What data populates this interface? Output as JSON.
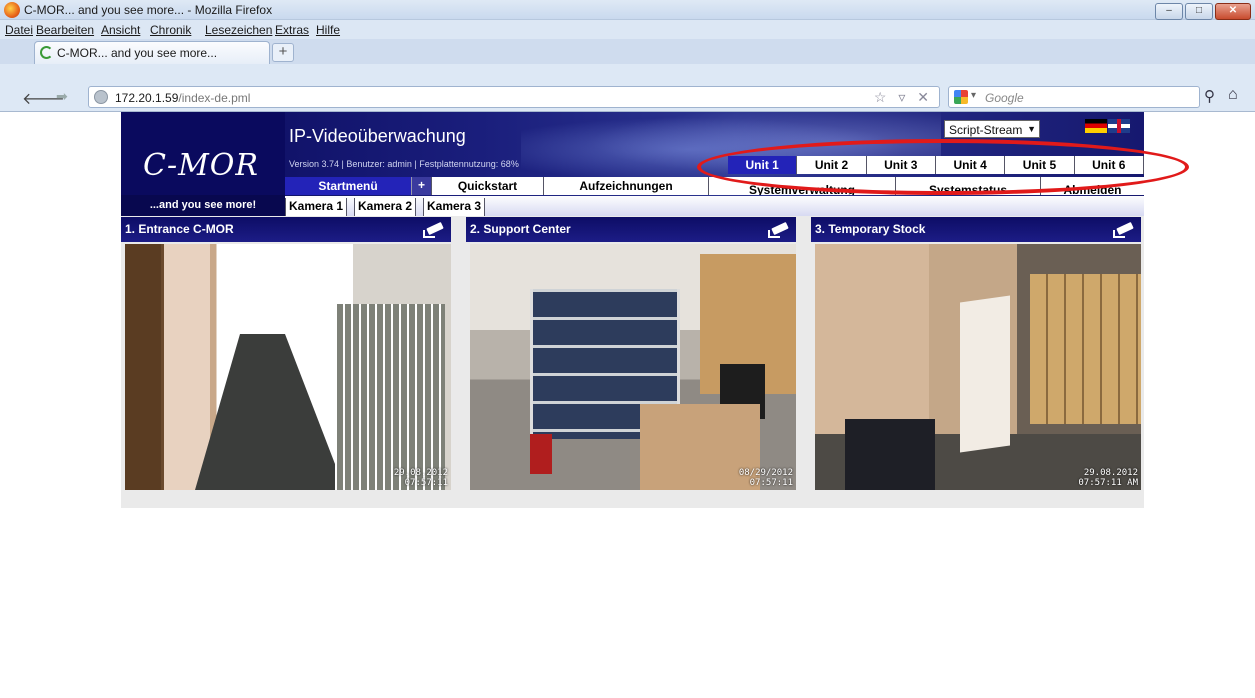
{
  "window": {
    "title": "C-MOR... and you see more... - Mozilla Firefox",
    "minimize": "–",
    "maximize": "□",
    "close": "✕"
  },
  "menubar": {
    "items": [
      "Datei",
      "Bearbeiten",
      "Ansicht",
      "Chronik",
      "Lesezeichen",
      "Extras",
      "Hilfe"
    ]
  },
  "tabs": {
    "active_label": "C-MOR... and you see more...",
    "new_tab_label": "+"
  },
  "navbar": {
    "back": "🡐",
    "forward": "➡",
    "url_host": "172.20.1.59",
    "url_path": "/index-de.pml",
    "url_icons": "☆ ▿ ✕",
    "search_engine_arrow": "▾",
    "search_placeholder": "Google",
    "search_icon": "⚲",
    "home_icon": "⌂"
  },
  "app": {
    "logo": "C-MOR",
    "tagline": "...and you see more!",
    "title": "IP-Videoüberwachung",
    "version_line": "Version 3.74 | Benutzer: admin | Festplattennutzung: 68%",
    "stream_select": {
      "value": "Script-Stream",
      "arrow": "▼"
    },
    "units": [
      "Unit 1",
      "Unit 2",
      "Unit 3",
      "Unit 4",
      "Unit 5",
      "Unit 6"
    ],
    "active_unit_index": 0,
    "menu": [
      "Startmenü",
      "Quickstart",
      "Aufzeichnungen",
      "Systemverwaltung",
      "Systemstatus",
      "Abmelden"
    ],
    "menu_plus": "+",
    "cameras": [
      "Kamera 1",
      "Kamera 2",
      "Kamera 3"
    ]
  },
  "camera_panels": [
    {
      "title": "1. Entrance C-MOR",
      "stamp_date": "29.08.2012",
      "stamp_time": "07:57:11"
    },
    {
      "title": "2. Support Center",
      "stamp_date": "08/29/2012",
      "stamp_time": "07:57:11"
    },
    {
      "title": "3. Temporary Stock",
      "stamp_date": "29.08.2012",
      "stamp_time": "07:57:11 AM"
    }
  ],
  "colors": {
    "header_blue": "#1a1e7c",
    "active_tab": "#2323b8",
    "annotation": "#e11a1a"
  }
}
